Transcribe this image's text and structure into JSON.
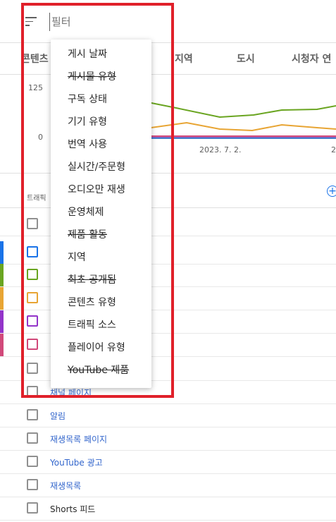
{
  "filter": {
    "placeholder": "필터"
  },
  "tabs": [
    "콘텐츠",
    "지역",
    "도시",
    "시청자 연"
  ],
  "chart": {
    "y_ticks": [
      "125",
      "0"
    ],
    "x_ticks": [
      "2023. 7. 2.",
      "2"
    ],
    "series_colors": [
      "#6aa521",
      "#e8a534",
      "#d1497a",
      "#7b3fb5",
      "#1c6ec4"
    ]
  },
  "table": {
    "header": "트래픽",
    "rows": [
      {
        "label": "",
        "stripe": "",
        "visible": false
      },
      {
        "label": "",
        "stripe": "#1a73e8",
        "visible": false
      },
      {
        "label": "",
        "stripe": "#6aa521",
        "visible": false
      },
      {
        "label": "",
        "stripe": "#e8a534",
        "visible": false
      },
      {
        "label": "",
        "stripe": "#9334c9",
        "visible": false
      },
      {
        "label": "",
        "stripe": "#d1497a",
        "visible": false
      },
      {
        "label": "",
        "stripe": "",
        "visible": false
      },
      {
        "label": "채널 페이지",
        "stripe": ""
      },
      {
        "label": "알림",
        "stripe": ""
      },
      {
        "label": "재생목록 페이지",
        "stripe": ""
      },
      {
        "label": "YouTube 광고",
        "stripe": ""
      },
      {
        "label": "재생목록",
        "stripe": ""
      },
      {
        "label": "Shorts 피드",
        "stripe": ""
      }
    ],
    "checkbox_colors": [
      "#909090",
      "#1a73e8",
      "#6aa521",
      "#e8a534",
      "#9334c9",
      "#d1497a",
      "#909090"
    ]
  },
  "menu": {
    "items": [
      {
        "label": "게시 날짜",
        "struck": false
      },
      {
        "label": "게시물 유형",
        "struck": true
      },
      {
        "label": "구독 상태",
        "struck": false
      },
      {
        "label": "기기 유형",
        "struck": false
      },
      {
        "label": "번역 사용",
        "struck": false
      },
      {
        "label": "실시간/주문형",
        "struck": false
      },
      {
        "label": "오디오만 재생",
        "struck": false
      },
      {
        "label": "운영체제",
        "struck": false
      },
      {
        "label": "제품 활동",
        "struck": true
      },
      {
        "label": "지역",
        "struck": false
      },
      {
        "label": "최초 공개됨",
        "struck": true
      },
      {
        "label": "콘텐츠 유형",
        "struck": false
      },
      {
        "label": "트래픽 소스",
        "struck": false
      },
      {
        "label": "플레이어 유형",
        "struck": false
      },
      {
        "label": "YouTube 제품",
        "struck": true
      }
    ]
  },
  "annotation": {
    "color": "#e0202a"
  }
}
